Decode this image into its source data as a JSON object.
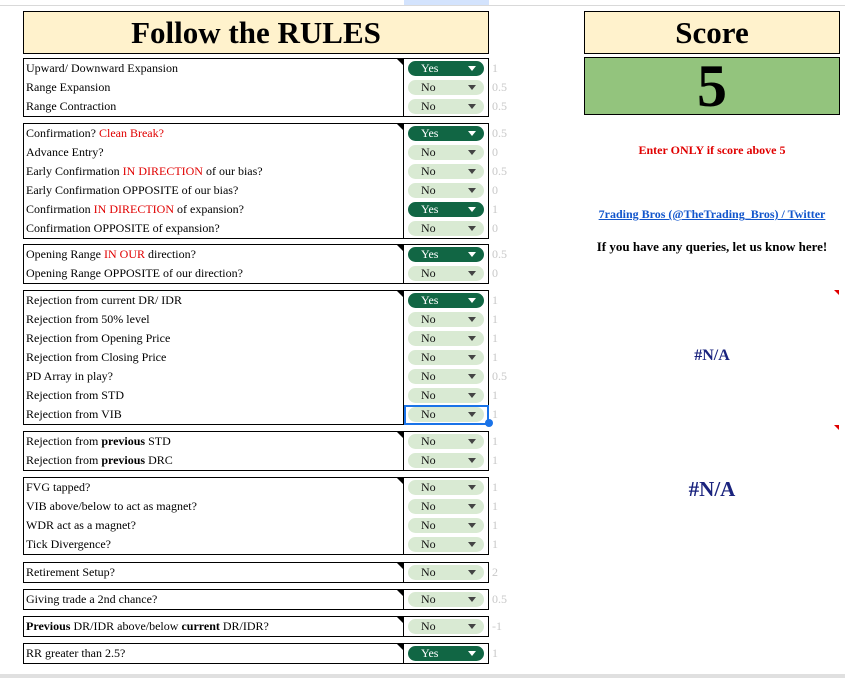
{
  "header": {
    "title": "Follow the RULES"
  },
  "score_panel": {
    "title": "Score",
    "value": "5",
    "enter_note": "Enter ONLY if score above 5",
    "link_text": "7rading Bros (@TheTrading_Bros) / Twitter",
    "queries_text": "If you have any queries, let us know here!",
    "na_small": "#N/A",
    "na_large": "#N/A"
  },
  "groups": [
    {
      "rows": [
        {
          "parts": [
            {
              "t": "Upward/ Downward Expansion"
            }
          ],
          "value": "Yes",
          "score": "1"
        },
        {
          "parts": [
            {
              "t": "Range Expansion"
            }
          ],
          "value": "No",
          "score": "0.5"
        },
        {
          "parts": [
            {
              "t": "Range Contraction"
            }
          ],
          "value": "No",
          "score": "0.5"
        }
      ]
    },
    {
      "rows": [
        {
          "parts": [
            {
              "t": "Confirmation? "
            },
            {
              "t": "Clean Break?",
              "s": "red"
            }
          ],
          "value": "Yes",
          "score": "0.5"
        },
        {
          "parts": [
            {
              "t": "Advance Entry?"
            }
          ],
          "value": "No",
          "score": "0"
        },
        {
          "parts": [
            {
              "t": "Early Confirmation "
            },
            {
              "t": "IN DIRECTION",
              "s": "red"
            },
            {
              "t": " of  our bias?"
            }
          ],
          "value": "No",
          "score": "0.5"
        },
        {
          "parts": [
            {
              "t": "Early Confirmation OPPOSITE of our bias?"
            }
          ],
          "value": "No",
          "score": "0"
        },
        {
          "parts": [
            {
              "t": "Confirmation "
            },
            {
              "t": "IN DIRECTION",
              "s": "red"
            },
            {
              "t": " of expansion?"
            }
          ],
          "value": "Yes",
          "score": "1"
        },
        {
          "parts": [
            {
              "t": "Confirmation OPPOSITE of expansion?"
            }
          ],
          "value": "No",
          "score": "0"
        }
      ]
    },
    {
      "rows": [
        {
          "parts": [
            {
              "t": "Opening Range "
            },
            {
              "t": "IN OUR",
              "s": "red"
            },
            {
              "t": " direction?"
            }
          ],
          "value": "Yes",
          "score": "0.5"
        },
        {
          "parts": [
            {
              "t": "Opening Range OPPOSITE of our direction?"
            }
          ],
          "value": "No",
          "score": "0"
        }
      ]
    },
    {
      "rows": [
        {
          "parts": [
            {
              "t": "Rejection from current DR/ IDR"
            }
          ],
          "value": "Yes",
          "score": "1"
        },
        {
          "parts": [
            {
              "t": "Rejection from 50% level"
            }
          ],
          "value": "No",
          "score": "1"
        },
        {
          "parts": [
            {
              "t": "Rejection from Opening Price"
            }
          ],
          "value": "No",
          "score": "1"
        },
        {
          "parts": [
            {
              "t": "Rejection from Closing Price"
            }
          ],
          "value": "No",
          "score": "1"
        },
        {
          "parts": [
            {
              "t": "PD Array in play?"
            }
          ],
          "value": "No",
          "score": "0.5"
        },
        {
          "parts": [
            {
              "t": "Rejection from STD"
            }
          ],
          "value": "No",
          "score": "1"
        },
        {
          "parts": [
            {
              "t": "Rejection from VIB"
            }
          ],
          "value": "No",
          "score": "1"
        }
      ]
    },
    {
      "rows": [
        {
          "parts": [
            {
              "t": "Rejection from "
            },
            {
              "t": "previous",
              "s": "bold"
            },
            {
              "t": " STD"
            }
          ],
          "value": "No",
          "score": "1"
        },
        {
          "parts": [
            {
              "t": "Rejection from "
            },
            {
              "t": "previous",
              "s": "bold"
            },
            {
              "t": " DRC"
            }
          ],
          "value": "No",
          "score": "1"
        }
      ]
    },
    {
      "rows": [
        {
          "parts": [
            {
              "t": "FVG tapped?"
            }
          ],
          "value": "No",
          "score": "1"
        },
        {
          "parts": [
            {
              "t": "VIB above/below to act as magnet?"
            }
          ],
          "value": "No",
          "score": "1"
        },
        {
          "parts": [
            {
              "t": "WDR act as a magnet?"
            }
          ],
          "value": "No",
          "score": "1"
        },
        {
          "parts": [
            {
              "t": "Tick Divergence?"
            }
          ],
          "value": "No",
          "score": "1"
        }
      ]
    },
    {
      "rows": [
        {
          "parts": [
            {
              "t": "Retirement Setup?"
            }
          ],
          "value": "No",
          "score": "2"
        }
      ]
    },
    {
      "rows": [
        {
          "parts": [
            {
              "t": "Giving trade a 2nd chance?"
            }
          ],
          "value": "No",
          "score": "0.5"
        }
      ]
    },
    {
      "rows": [
        {
          "parts": [
            {
              "t": "Previous",
              "s": "bold"
            },
            {
              "t": " DR/IDR above/below "
            },
            {
              "t": "current",
              "s": "bold"
            },
            {
              "t": " DR/IDR?"
            }
          ],
          "value": "No",
          "score": "-1"
        }
      ]
    },
    {
      "rows": [
        {
          "parts": [
            {
              "t": "RR greater than 2.5?"
            }
          ],
          "value": "Yes",
          "score": "1"
        }
      ]
    }
  ]
}
